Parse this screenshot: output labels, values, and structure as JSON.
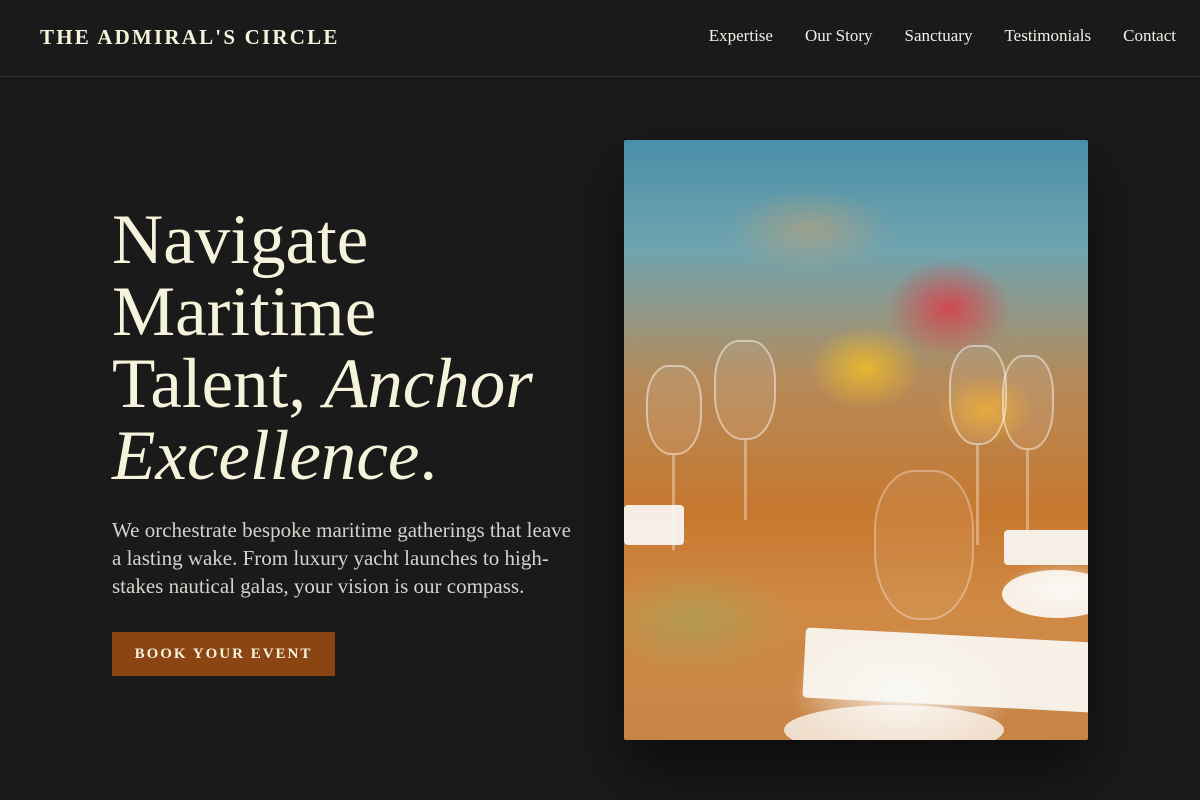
{
  "brand": {
    "name": "THE ADMIRAL'S CIRCLE"
  },
  "nav": {
    "items": [
      {
        "label": "Expertise"
      },
      {
        "label": "Our Story"
      },
      {
        "label": "Sanctuary"
      },
      {
        "label": "Testimonials"
      },
      {
        "label": "Contact"
      }
    ]
  },
  "hero": {
    "title_line1": "Navigate",
    "title_line2": "Maritime",
    "title_line3a": "Talent, ",
    "title_line3b_em": "Anchor",
    "title_line4_em": "Excellence",
    "title_line4_end": ".",
    "subtitle": "We orchestrate bespoke maritime gatherings that leave a lasting wake. From luxury yacht launches to high-stakes nautical galas, your vision is our compass.",
    "cta_label": "BOOK YOUR EVENT"
  },
  "colors": {
    "background": "#1a1a1a",
    "cream": "#f5f3dc",
    "accent_rust": "#8b4513",
    "body_text": "#d4d2cc"
  }
}
